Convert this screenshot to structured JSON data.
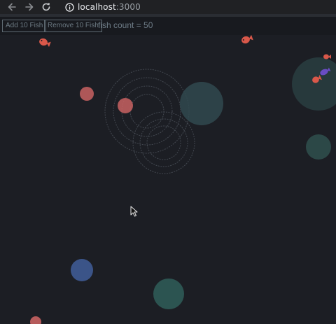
{
  "browser": {
    "url_host": "localhost",
    "url_port": ":3000",
    "back_icon": "arrow-left-icon",
    "forward_icon": "arrow-right-icon",
    "reload_icon": "reload-icon",
    "info_icon": "info-icon"
  },
  "toolbar": {
    "add_label": "Add 10 Fish",
    "remove_label": "Remove 10 Fish",
    "count_label": "fish count = 50"
  },
  "colors": {
    "fish": "#d9584a",
    "fish_purple": "#6a4cc4",
    "bubble_red": "#e06e6c",
    "bubble_teal": "#3a6a68",
    "bubble_blue": "#4b68a8",
    "ripple": "#5a606a"
  }
}
